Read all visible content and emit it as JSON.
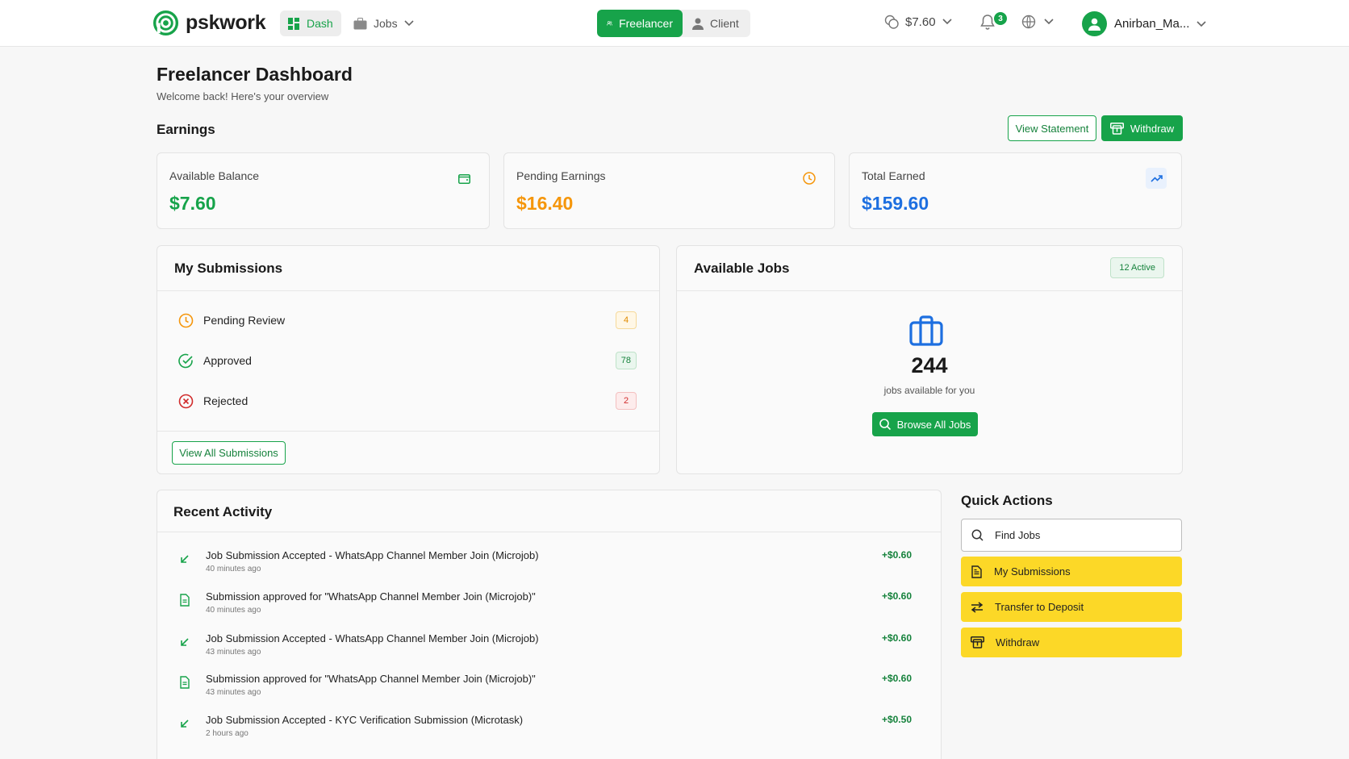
{
  "nav": {
    "brand": "pskwork",
    "dash_label": "Dash",
    "jobs_label": "Jobs",
    "role_freelancer": "Freelancer",
    "role_client": "Client",
    "wallet_balance": "$7.60",
    "notification_count": "3",
    "username": "Anirban_Ma..."
  },
  "header": {
    "title": "Freelancer Dashboard",
    "subtitle": "Welcome back! Here's your overview"
  },
  "earnings": {
    "title": "Earnings",
    "view_statement": "View Statement",
    "withdraw": "Withdraw",
    "cards": [
      {
        "label": "Available Balance",
        "value": "$7.60",
        "color": "#16a34a"
      },
      {
        "label": "Pending Earnings",
        "value": "$16.40",
        "color": "#f5960b"
      },
      {
        "label": "Total Earned",
        "value": "$159.60",
        "color": "#1d6fe0"
      }
    ]
  },
  "submissions": {
    "title": "My Submissions",
    "rows": [
      {
        "label": "Pending Review",
        "count": "4"
      },
      {
        "label": "Approved",
        "count": "78"
      },
      {
        "label": "Rejected",
        "count": "2"
      }
    ],
    "view_all": "View All Submissions"
  },
  "available_jobs": {
    "title": "Available Jobs",
    "active_badge": "12 Active",
    "count": "244",
    "caption": "jobs available for you",
    "browse": "Browse All Jobs"
  },
  "recent_activity": {
    "title": "Recent Activity",
    "items": [
      {
        "icon": "arrow-down-left-icon",
        "title": "Job Submission Accepted - WhatsApp Channel Member Join (Microjob)",
        "time": "40 minutes ago",
        "amount": "+$0.60"
      },
      {
        "icon": "document-icon",
        "title": "Submission approved for \"WhatsApp Channel Member Join (Microjob)\"",
        "time": "40 minutes ago",
        "amount": "+$0.60"
      },
      {
        "icon": "arrow-down-left-icon",
        "title": "Job Submission Accepted - WhatsApp Channel Member Join (Microjob)",
        "time": "43 minutes ago",
        "amount": "+$0.60"
      },
      {
        "icon": "document-icon",
        "title": "Submission approved for \"WhatsApp Channel Member Join (Microjob)\"",
        "time": "43 minutes ago",
        "amount": "+$0.60"
      },
      {
        "icon": "arrow-down-left-icon",
        "title": "Job Submission Accepted - KYC Verification Submission (Microtask)",
        "time": "2 hours ago",
        "amount": "+$0.50"
      }
    ]
  },
  "quick_actions": {
    "title": "Quick Actions",
    "find_jobs": "Find Jobs",
    "my_submissions": "My Submissions",
    "transfer": "Transfer to Deposit",
    "withdraw": "Withdraw"
  },
  "colors": {
    "brand_green": "#17a34a",
    "quick_action_yellow": "#fcd827"
  }
}
